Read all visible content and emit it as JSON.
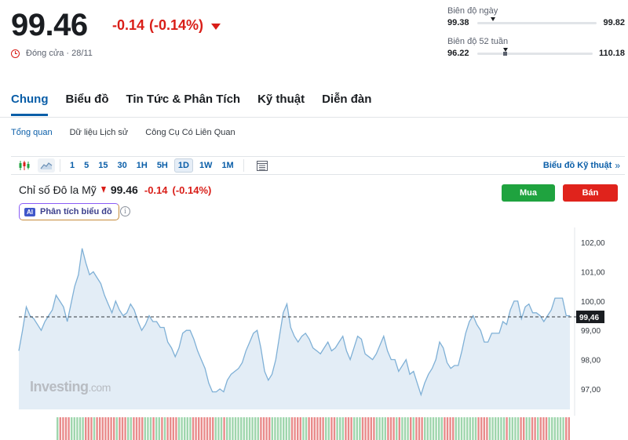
{
  "quote": {
    "price": "99.46",
    "change": "-0.14",
    "change_pct": "(-0.14%)",
    "status": "Đóng cửa · 28/11"
  },
  "day_range": {
    "label": "Biên độ ngày",
    "low": "99.38",
    "high": "99.82"
  },
  "week52_range": {
    "label": "Biên độ 52 tuần",
    "low": "96.22",
    "high": "110.18"
  },
  "tabs": [
    {
      "label": "Chung",
      "active": true
    },
    {
      "label": "Biểu đồ"
    },
    {
      "label": "Tin Tức & Phân Tích"
    },
    {
      "label": "Kỹ thuật"
    },
    {
      "label": "Diễn đàn"
    }
  ],
  "subtabs": [
    {
      "label": "Tổng quan",
      "active": true
    },
    {
      "label": "Dữ liệu Lịch sử"
    },
    {
      "label": "Công Cụ Có Liên Quan"
    }
  ],
  "toolbar": {
    "timeframes": [
      "1",
      "5",
      "15",
      "30",
      "1H",
      "5H",
      "1D",
      "1W",
      "1M"
    ],
    "active_timeframe": "1D",
    "tech_chart_label": "Biểu đồ Kỹ thuật",
    "tech_chart_arrow": "»"
  },
  "chart_header": {
    "name": "Chỉ số Đô la Mỹ",
    "price": "99.46",
    "change": "-0.14",
    "change_pct": "(-0.14%)",
    "buy_label": "Mua",
    "sell_label": "Bán",
    "ai_badge": "AI",
    "ai_label": "Phân tích biểu đồ",
    "info_glyph": "i"
  },
  "watermark": {
    "brand": "Investing",
    "suffix": ".com"
  },
  "colors": {
    "accent": "#0a5ea8",
    "down": "#d91e18",
    "up": "#1fa33f",
    "line": "#7fb0d6",
    "fill": "#e3edf6"
  },
  "chart_data": {
    "type": "area",
    "y_ticks": [
      "102,00",
      "101,00",
      "100,00",
      "99,00",
      "98,00",
      "97,00"
    ],
    "current_label": "99,46",
    "current_value": 99.46,
    "ylim": [
      96.3,
      102.3
    ],
    "values": [
      98.3,
      99.0,
      99.8,
      99.5,
      99.4,
      99.2,
      99.0,
      99.3,
      99.5,
      99.7,
      100.2,
      100.0,
      99.8,
      99.3,
      99.9,
      100.5,
      100.9,
      101.8,
      101.3,
      100.9,
      101.0,
      100.8,
      100.6,
      100.2,
      99.9,
      99.6,
      100.0,
      99.7,
      99.5,
      99.6,
      99.9,
      99.7,
      99.3,
      99.0,
      99.2,
      99.5,
      99.3,
      99.3,
      99.1,
      99.1,
      98.6,
      98.4,
      98.1,
      98.4,
      98.9,
      99.0,
      99.0,
      98.7,
      98.3,
      98.0,
      97.7,
      97.2,
      96.9,
      96.9,
      97.0,
      96.9,
      97.3,
      97.5,
      97.6,
      97.7,
      97.9,
      98.3,
      98.6,
      98.9,
      99.0,
      98.4,
      97.6,
      97.3,
      97.5,
      98.0,
      98.8,
      99.6,
      99.9,
      99.1,
      98.8,
      98.6,
      98.8,
      98.9,
      98.7,
      98.4,
      98.3,
      98.2,
      98.4,
      98.6,
      98.3,
      98.4,
      98.6,
      98.8,
      98.3,
      98.0,
      98.4,
      98.8,
      98.7,
      98.2,
      98.1,
      98.0,
      98.2,
      98.5,
      98.8,
      98.3,
      98.0,
      98.0,
      97.6,
      97.8,
      98.0,
      97.5,
      97.6,
      97.2,
      96.8,
      97.2,
      97.5,
      97.7,
      98.0,
      98.6,
      98.4,
      97.9,
      97.7,
      97.8,
      97.8,
      98.3,
      98.9,
      99.3,
      99.5,
      99.2,
      99.0,
      98.6,
      98.6,
      98.9,
      98.9,
      98.9,
      99.3,
      99.2,
      99.7,
      100.0,
      100.0,
      99.4,
      99.8,
      99.9,
      99.6,
      99.6,
      99.5,
      99.3,
      99.5,
      99.7,
      100.1,
      100.1,
      100.1,
      99.5,
      99.5
    ]
  }
}
